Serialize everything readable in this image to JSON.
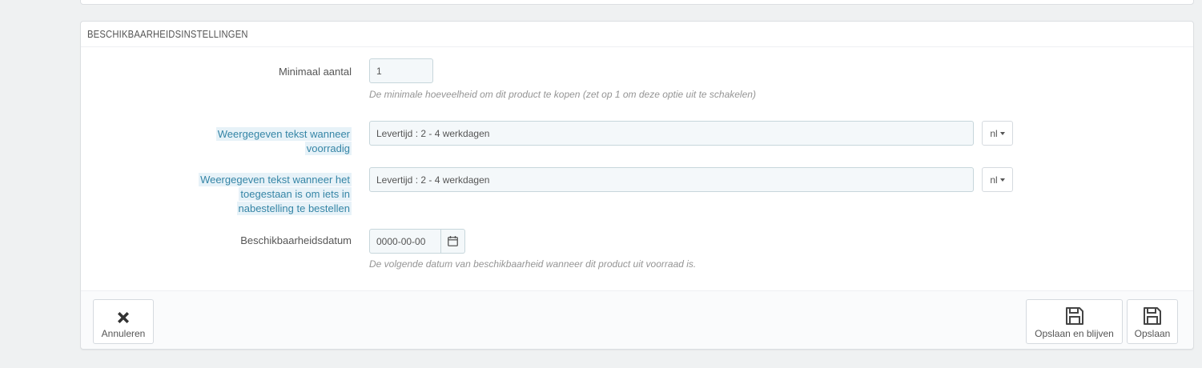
{
  "panel": {
    "title": "BESCHIKBAARHEIDSINSTELLINGEN"
  },
  "fields": {
    "min_qty": {
      "label": "Minimaal aantal",
      "value": "1",
      "help": "De minimale hoeveelheid om dit product te kopen (zet op 1 om deze optie uit te schakelen)"
    },
    "in_stock_text": {
      "label_line1": "Weergegeven tekst wanneer",
      "label_line2": "voorradig",
      "value": "Levertijd : 2 - 4 werkdagen",
      "lang": "nl"
    },
    "backorder_text": {
      "label_line1": "Weergegeven tekst wanneer het",
      "label_line2": "toegestaan is om iets in",
      "label_line3": "nabestelling te bestellen",
      "value": "Levertijd : 2 - 4 werkdagen",
      "lang": "nl"
    },
    "available_date": {
      "label": "Beschikbaarheidsdatum",
      "value": "0000-00-00",
      "help": "De volgende datum van beschikbaarheid wanneer dit product uit voorraad is."
    }
  },
  "footer": {
    "cancel_label": "Annuleren",
    "save_stay_label": "Opslaan en blijven",
    "save_label": "Opslaan"
  },
  "icons": {
    "cancel": "close-icon",
    "save_stay": "floppy-disk-icon",
    "save": "floppy-disk-icon",
    "date": "calendar-icon"
  }
}
